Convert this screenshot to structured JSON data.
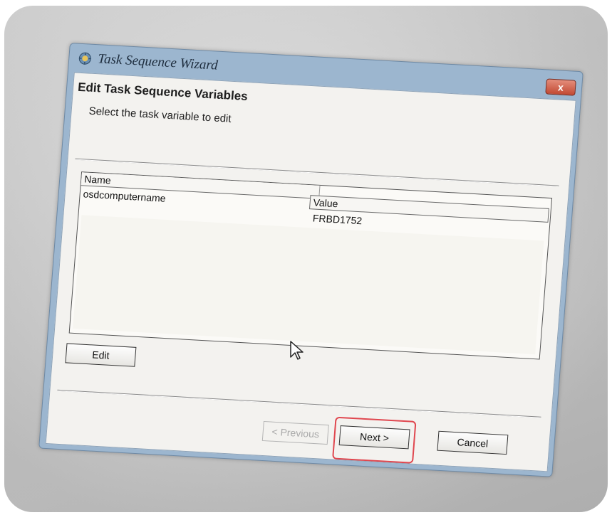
{
  "window": {
    "title": "Task Sequence Wizard",
    "close_label": "x"
  },
  "page": {
    "heading": "Edit Task Sequence Variables",
    "subtitle": "Select the task variable to edit"
  },
  "variables_table": {
    "columns": [
      "Name",
      "Value"
    ],
    "rows": [
      {
        "name": "osdcomputername",
        "value": "FRBD1752"
      }
    ]
  },
  "buttons": {
    "edit": "Edit",
    "previous": "< Previous",
    "next": "Next >",
    "cancel": "Cancel"
  },
  "colors": {
    "highlight": "#e0474f",
    "title_bar": "#9cb6cf"
  }
}
